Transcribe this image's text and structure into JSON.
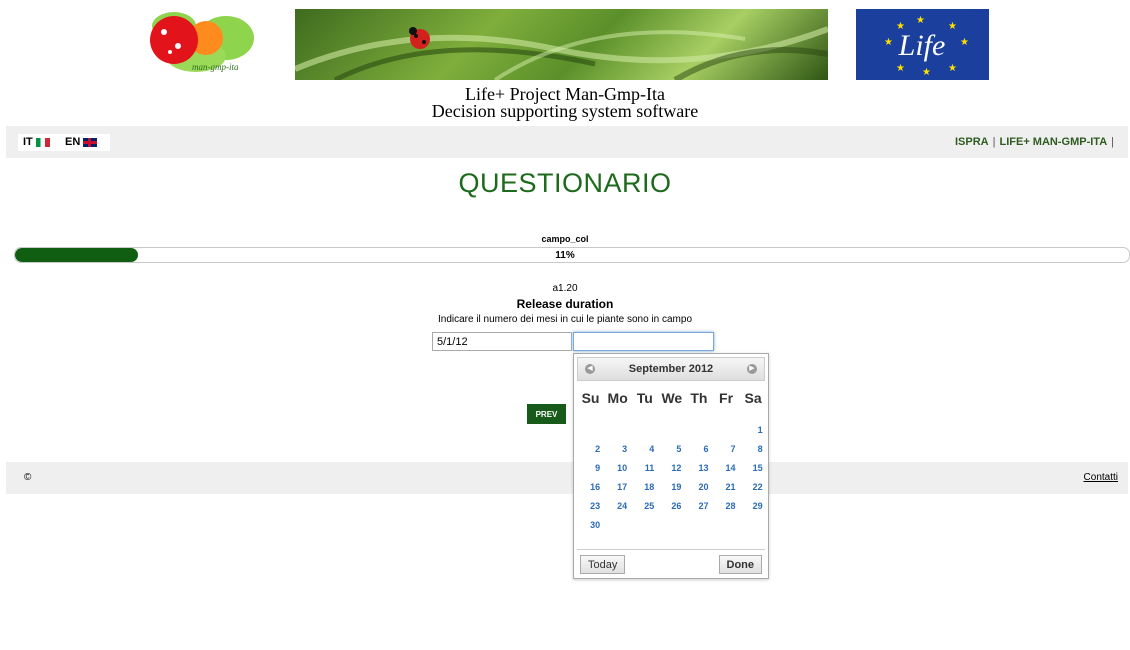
{
  "header": {
    "logo_text": "man-gmp-ita",
    "life_logo_text": "Life",
    "title_line1": "Life+ Project Man-Gmp-Ita",
    "title_line2": "Decision supporting system software"
  },
  "nav": {
    "lang_it": "IT",
    "lang_en": "EN",
    "links": [
      "ISPRA",
      "LIFE+ MAN-GMP-ITA"
    ],
    "separator": "|"
  },
  "page": {
    "title": "QUESTIONARIO"
  },
  "progress": {
    "label": "campo_col",
    "percent_text": "11%",
    "value": 0.11
  },
  "question": {
    "code": "a1.20",
    "title": "Release duration",
    "description": "Indicare il numero dei mesi in cui le piante sono in campo",
    "start_value": "5/1/12",
    "end_value": "",
    "prev_label": "PREV"
  },
  "footer": {
    "copyright": "©",
    "contact_label": "Contatti"
  },
  "datepicker": {
    "month_label": "September 2012",
    "days_of_week": [
      "Su",
      "Mo",
      "Tu",
      "We",
      "Th",
      "Fr",
      "Sa"
    ],
    "weeks": [
      [
        "",
        "",
        "",
        "",
        "",
        "",
        "1"
      ],
      [
        "2",
        "3",
        "4",
        "5",
        "6",
        "7",
        "8"
      ],
      [
        "9",
        "10",
        "11",
        "12",
        "13",
        "14",
        "15"
      ],
      [
        "16",
        "17",
        "18",
        "19",
        "20",
        "21",
        "22"
      ],
      [
        "23",
        "24",
        "25",
        "26",
        "27",
        "28",
        "29"
      ],
      [
        "30",
        "",
        "",
        "",
        "",
        "",
        ""
      ]
    ],
    "today_label": "Today",
    "done_label": "Done"
  },
  "colors": {
    "accent_green": "#1d6a1d",
    "progress_fill": "#105e12",
    "calendar_day": "#2a6bb7"
  }
}
